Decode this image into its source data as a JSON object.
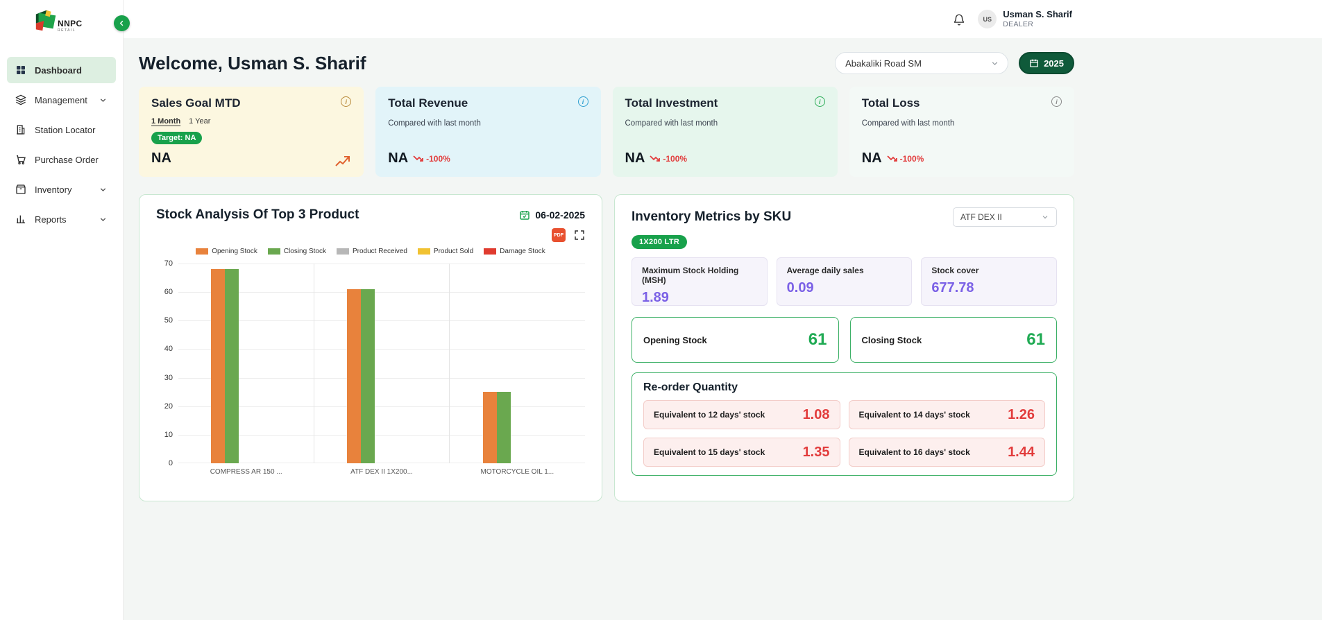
{
  "brand": {
    "name": "NNPC",
    "subtitle": "RETAIL"
  },
  "icons": {
    "info": "i"
  },
  "topbar": {
    "avatar_initials": "US",
    "user_name": "Usman S. Sharif",
    "user_role": "DEALER"
  },
  "sidebar": {
    "items": [
      {
        "label": "Dashboard",
        "active": true
      },
      {
        "label": "Management",
        "expandable": true
      },
      {
        "label": "Station Locator"
      },
      {
        "label": "Purchase Order"
      },
      {
        "label": "Inventory",
        "expandable": true
      },
      {
        "label": "Reports",
        "expandable": true
      }
    ]
  },
  "header": {
    "welcome_title": "Welcome, Usman S. Sharif",
    "station_selected": "Abakaliki Road SM",
    "year_selected": "2025"
  },
  "stats": [
    {
      "title": "Sales Goal MTD",
      "tabs": [
        "1 Month",
        "1 Year"
      ],
      "target_badge": "Target: NA",
      "value": "NA",
      "bg": "#fcf7e0",
      "info_color": "#b98a3a"
    },
    {
      "title": "Total Revenue",
      "subtitle": "Compared with last month",
      "value": "NA",
      "delta": "-100%",
      "bg": "#e2f4f9",
      "info_color": "#2f9fd0"
    },
    {
      "title": "Total Investment",
      "subtitle": "Compared with last month",
      "value": "NA",
      "delta": "-100%",
      "bg": "#e6f6ed",
      "info_color": "#2fae5b"
    },
    {
      "title": "Total Loss",
      "subtitle": "Compared with last month",
      "value": "NA",
      "delta": "-100%",
      "bg": "#f3f9f6",
      "info_color": "#8a8a8a"
    }
  ],
  "stock_panel": {
    "title": "Stock Analysis Of Top 3 Product",
    "date": "06-02-2025",
    "pdf_icon": "PDF"
  },
  "chart_data": {
    "type": "bar",
    "title": "Stock Analysis Of Top 3 Product",
    "categories": [
      "COMPRESS AR 150 ...",
      "ATF DEX II 1X200...",
      "MOTORCYCLE OIL 1..."
    ],
    "series": [
      {
        "name": "Opening Stock",
        "color": "#e8823c",
        "values": [
          68,
          61,
          25
        ]
      },
      {
        "name": "Closing Stock",
        "color": "#6aa84f",
        "values": [
          68,
          61,
          25
        ]
      },
      {
        "name": "Product Received",
        "color": "#b7b7b7",
        "values": [
          0,
          0,
          0
        ]
      },
      {
        "name": "Product Sold",
        "color": "#f1c232",
        "values": [
          0,
          0,
          0
        ]
      },
      {
        "name": "Damage Stock",
        "color": "#e03b2f",
        "values": [
          0,
          0,
          0
        ]
      }
    ],
    "ylim": [
      0,
      70
    ],
    "yticks": [
      0,
      10,
      20,
      30,
      40,
      50,
      60,
      70
    ],
    "grid": true,
    "legend_position": "top"
  },
  "inventory_panel": {
    "title": "Inventory Metrics by SKU",
    "sku_selected": "ATF DEX II",
    "pack_badge": "1X200 LTR",
    "metrics": [
      {
        "label": "Maximum Stock Holding (MSH)",
        "value": "1.89"
      },
      {
        "label": "Average daily sales",
        "value": "0.09"
      },
      {
        "label": "Stock cover",
        "value": "677.78"
      }
    ],
    "stock_summary": [
      {
        "label": "Opening Stock",
        "value": "61"
      },
      {
        "label": "Closing Stock",
        "value": "61"
      }
    ],
    "reorder": {
      "title": "Re-order Quantity",
      "items": [
        {
          "label": "Equivalent to 12 days' stock",
          "value": "1.08"
        },
        {
          "label": "Equivalent to 14 days' stock",
          "value": "1.26"
        },
        {
          "label": "Equivalent to 15 days' stock",
          "value": "1.35"
        },
        {
          "label": "Equivalent to 16 days' stock",
          "value": "1.44"
        }
      ]
    }
  },
  "colors": {
    "accent_green": "#18a14b",
    "dark_green_button": "#0f5a3a",
    "value_purple": "#7b61e6",
    "value_green": "#1faa53",
    "alert_red": "#e23c3c",
    "panel_border_green": "#c8e7d1"
  }
}
